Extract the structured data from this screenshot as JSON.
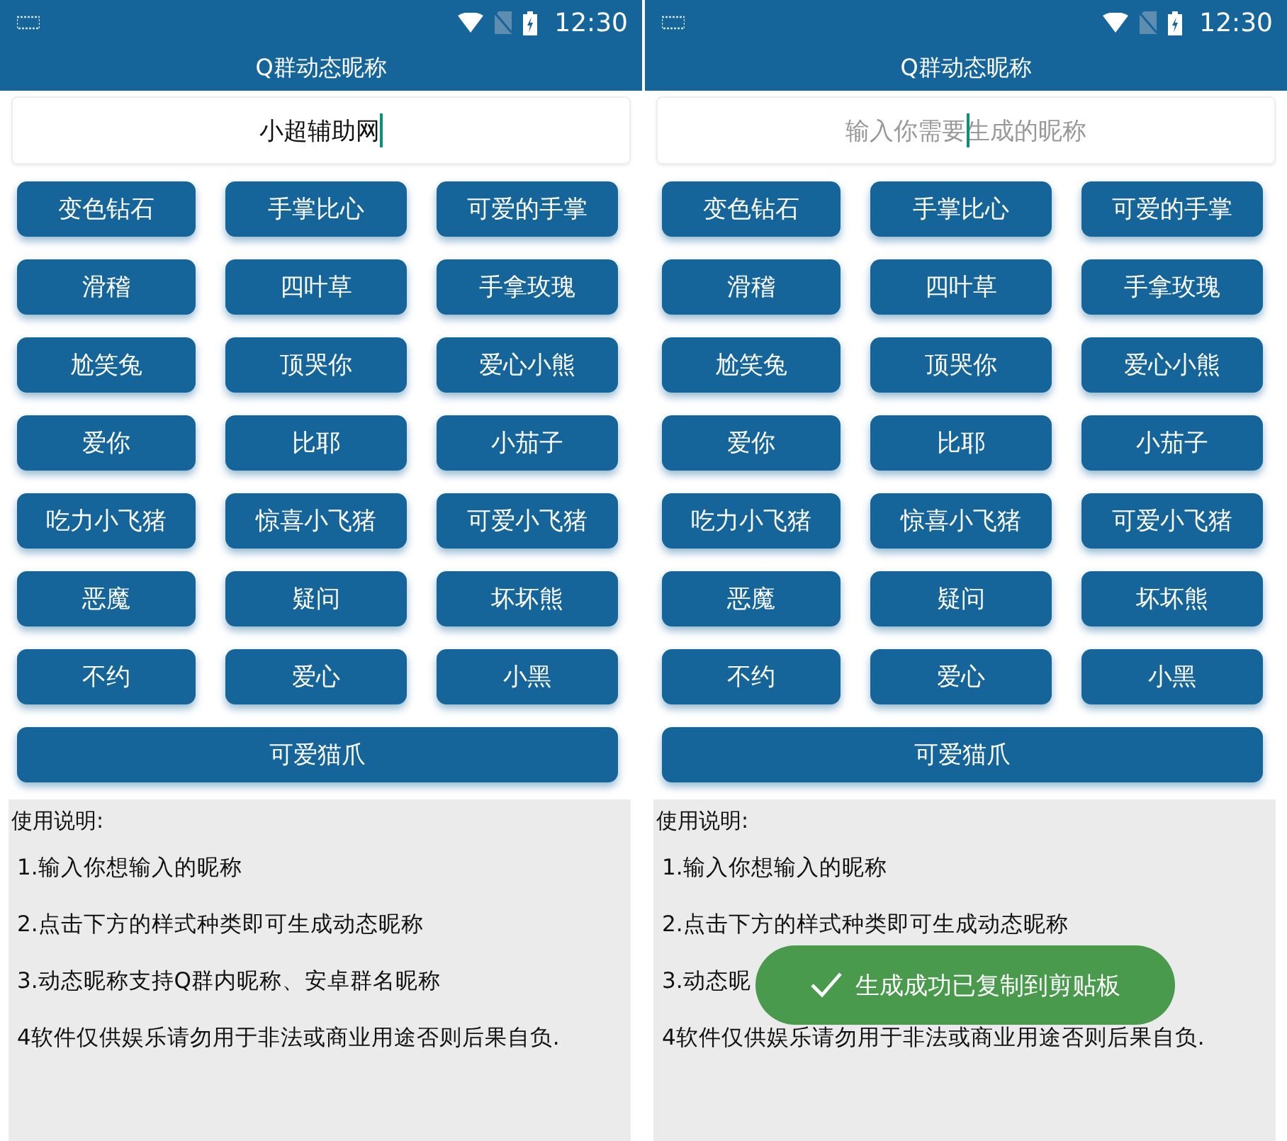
{
  "screens": [
    {
      "status_bar": {
        "time": "12:30"
      },
      "title": "Q群动态昵称",
      "field": {
        "value": "小超辅助网"
      },
      "buttons": [
        "变色钻石",
        "手掌比心",
        "可爱的手掌",
        "滑稽",
        "四叶草",
        "手拿玫瑰",
        "尬笑兔",
        "顶哭你",
        "爱心小熊",
        "爱你",
        "比耶",
        "小茄子",
        "吃力小飞猪",
        "惊喜小飞猪",
        "可爱小飞猪",
        "恶魔",
        "疑问",
        "坏坏熊",
        "不约",
        "爱心",
        "小黑"
      ],
      "wide_button": "可爱猫爪",
      "notes_title": "使用说明:",
      "notes": [
        "1.输入你想输入的昵称",
        "2.点击下方的样式种类即可生成动态昵称",
        "3.动态昵称支持Q群内昵称、安卓群名昵称",
        "4软件仅供娱乐请勿用于非法或商业用途否则后果自负."
      ]
    },
    {
      "status_bar": {
        "time": "12:30"
      },
      "title": "Q群动态昵称",
      "field": {
        "placeholder": "输入你需要生成的昵称"
      },
      "buttons": [
        "变色钻石",
        "手掌比心",
        "可爱的手掌",
        "滑稽",
        "四叶草",
        "手拿玫瑰",
        "尬笑兔",
        "顶哭你",
        "爱心小熊",
        "爱你",
        "比耶",
        "小茄子",
        "吃力小飞猪",
        "惊喜小飞猪",
        "可爱小飞猪",
        "恶魔",
        "疑问",
        "坏坏熊",
        "不约",
        "爱心",
        "小黑"
      ],
      "wide_button": "可爱猫爪",
      "notes_title": "使用说明:",
      "notes": [
        "1.输入你想输入的昵称",
        "2.点击下方的样式种类即可生成动态昵称",
        "3.动态昵",
        "4软件仅供娱乐请勿用于非法或商业用途否则后果自负."
      ],
      "toast": "生成成功已复制到剪贴板"
    }
  ]
}
